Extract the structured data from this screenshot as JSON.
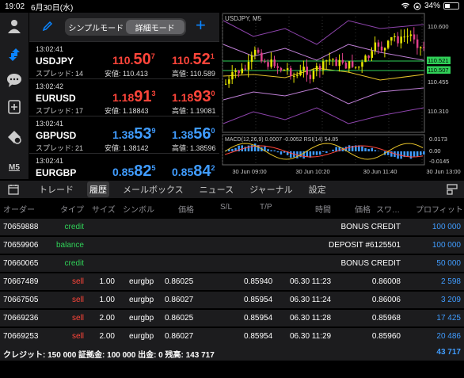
{
  "status": {
    "time": "19:02",
    "date": "6月30日(水)",
    "battery": "34%",
    "battery_level": 0.34
  },
  "sidebar": {
    "m5": "M5",
    "icons": [
      "person-icon",
      "trade-arrows-icon",
      "chat-icon",
      "add-chart-icon",
      "indicators-icon"
    ]
  },
  "header": {
    "simple_mode": "シンプルモード",
    "detail_mode": "詳細モード"
  },
  "quotes": [
    {
      "time": "13:02:41",
      "symbol": "USDJPY",
      "spread": "スプレッド: 14",
      "bid_pre": "110.",
      "bid_big": "50",
      "bid_sup": "7",
      "ask_pre": "110.",
      "ask_big": "52",
      "ask_sup": "1",
      "low": "安値: 110.413",
      "high": "高値: 110.589",
      "color": "#ff453a"
    },
    {
      "time": "13:02:42",
      "symbol": "EURUSD",
      "spread": "スプレッド: 17",
      "bid_pre": "1.18",
      "bid_big": "91",
      "bid_sup": "3",
      "ask_pre": "1.18",
      "ask_big": "93",
      "ask_sup": "0",
      "low": "安値: 1.18843",
      "high": "高値: 1.19081",
      "color": "#ff453a"
    },
    {
      "time": "13:02:41",
      "symbol": "GBPUSD",
      "spread": "スプレッド: 21",
      "bid_pre": "1.38",
      "bid_big": "53",
      "bid_sup": "9",
      "ask_pre": "1.38",
      "ask_big": "56",
      "ask_sup": "0",
      "low": "安値: 1.38142",
      "high": "高値: 1.38596",
      "color": "#409cff"
    },
    {
      "time": "13:02:41",
      "symbol": "EURGBP",
      "bid_pre": "0.85",
      "bid_big": "82",
      "bid_sup": "5",
      "ask_pre": "0.85",
      "ask_big": "84",
      "ask_sup": "2",
      "color": "#409cff"
    }
  ],
  "chart": {
    "title": "USDJPY, M5",
    "price_labels": [
      "110.600",
      "110.521",
      "110.507",
      "110.455",
      "110.310"
    ],
    "indicator_label": "MACD(12,26,9) 0.0007 -0.0052 RSI(14) 54.85",
    "indicator_scale": [
      "0.0173",
      "0.00",
      "-0.0145"
    ],
    "time_labels": [
      "30 Jun 09:00",
      "30 Jun 10:20",
      "30 Jun 11:40",
      "30 Jun 13:00"
    ]
  },
  "tabs": [
    "トレード",
    "履歴",
    "メールボックス",
    "ニュース",
    "ジャーナル",
    "設定"
  ],
  "active_tab": 1,
  "columns": [
    "オーダー",
    "タイプ",
    "サイズ",
    "シンボル",
    "価格",
    "S/L",
    "T/P",
    "時間",
    "価格",
    "スワ…",
    "プロフィット"
  ],
  "rows": [
    {
      "order": "70659888",
      "type": "credit",
      "size": "",
      "symbol": "",
      "price": "",
      "sl": "",
      "time": "",
      "close": "BONUS CREDIT",
      "profit": "100 000"
    },
    {
      "order": "70659906",
      "type": "balance",
      "size": "",
      "symbol": "",
      "price": "",
      "sl": "",
      "time": "",
      "close": "DEPOSIT #6125501",
      "profit": "100 000"
    },
    {
      "order": "70660065",
      "type": "credit",
      "size": "",
      "symbol": "",
      "price": "",
      "sl": "",
      "time": "",
      "close": "BONUS CREDIT",
      "profit": "50 000"
    },
    {
      "order": "70667489",
      "type": "sell",
      "size": "1.00",
      "symbol": "eurgbp",
      "price": "0.86025",
      "sl": "0.85940",
      "time": "06.30 11:23",
      "close": "0.86008",
      "profit": "2 598"
    },
    {
      "order": "70667505",
      "type": "sell",
      "size": "1.00",
      "symbol": "eurgbp",
      "price": "0.86027",
      "sl": "0.85954",
      "time": "06.30 11:24",
      "close": "0.86006",
      "profit": "3 209"
    },
    {
      "order": "70669236",
      "type": "sell",
      "size": "2.00",
      "symbol": "eurgbp",
      "price": "0.86025",
      "sl": "0.85954",
      "time": "06.30 11:28",
      "close": "0.85968",
      "profit": "17 425"
    },
    {
      "order": "70669253",
      "type": "sell",
      "size": "2.00",
      "symbol": "eurgbp",
      "price": "0.86027",
      "sl": "0.85954",
      "time": "06.30 11:29",
      "close": "0.85960",
      "profit": "20 486"
    }
  ],
  "footer": {
    "summary": "クレジット: 150 000 証拠金: 100 000 出金: 0 残高: 143 717",
    "total": "43 717"
  }
}
